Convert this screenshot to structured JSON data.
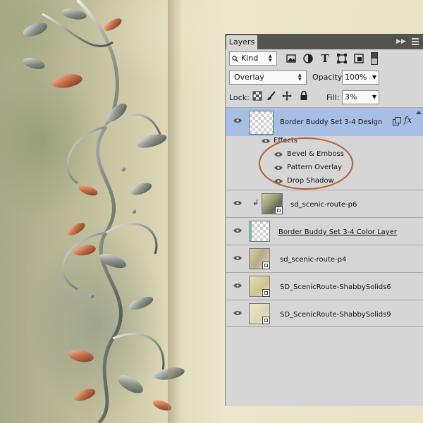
{
  "panel": {
    "tab_label": "Layers",
    "filter": {
      "kind_value": "Kind"
    },
    "blend": {
      "mode_value": "Overlay",
      "opacity_label": "Opacity:",
      "opacity_value": "100%"
    },
    "lock": {
      "label": "Lock:",
      "fill_label": "Fill:",
      "fill_value": "3%"
    },
    "layers": [
      {
        "name": "Border Buddy Set 3-4  Design",
        "selected": true,
        "has_fx": true,
        "thumb": "transparent"
      },
      {
        "name": "sd_scenic-route-p6",
        "clipped": true,
        "thumb": "paper-green"
      },
      {
        "name": "Border Buddy Set 3-4 Color Layer",
        "thumb": "transparent-teal"
      },
      {
        "name": "sd_scenic-route-p4",
        "thumb": "paper-beige"
      },
      {
        "name": "SD_ScenicRoute-ShabbySolids6",
        "thumb": "paper-cream"
      },
      {
        "name": "SD_ScenicRoute-ShabbySolids9",
        "thumb": "paper-light"
      }
    ],
    "effects": {
      "title": "Effects",
      "items": [
        "Bevel & Emboss",
        "Pattern Overlay",
        "Drop Shadow"
      ]
    }
  },
  "colors": {
    "panel_bg": "#d6d6d6",
    "topbar_bg": "#535353",
    "selected_row": "#a7bfe5",
    "highlight_ring": "#b5613e"
  }
}
